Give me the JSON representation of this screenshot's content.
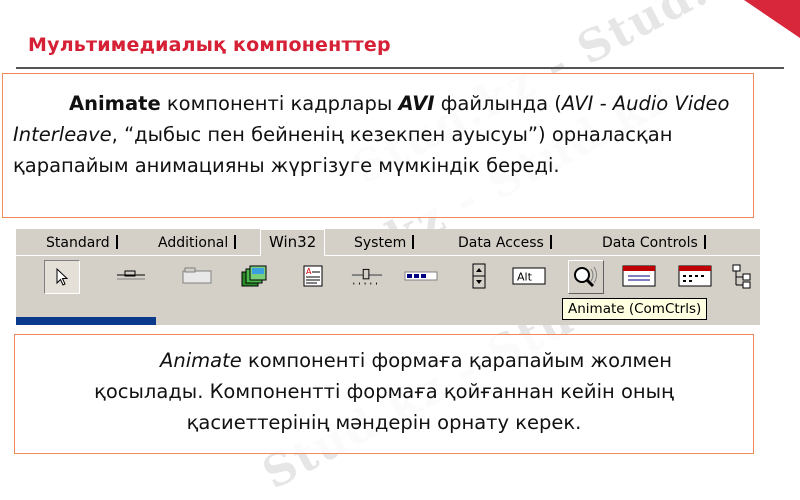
{
  "title": "Мультимедиалық компоненттер",
  "watermarks": [
    "Stud.kz - Stud.kz",
    "Stud.kz - Stud.kz",
    "Stud.kz - Stud.kz"
  ],
  "paragraph1": {
    "component": "Animate",
    "text_a": " компоненті кадрлары ",
    "format": "AVI",
    "text_b": " файлында (",
    "format_full": "AVI - Audio Video Interleave",
    "text_c": ", “дыбыс пен бейненің кезекпен ауысуы”) орналасқан қарапайым анимацияны жүргізуге мүмкіндік береді."
  },
  "palette": {
    "tabs": [
      {
        "label": "Standard"
      },
      {
        "label": "Additional"
      },
      {
        "label": "Win32"
      },
      {
        "label": "System"
      },
      {
        "label": "Data Access"
      },
      {
        "label": "Data Controls"
      }
    ],
    "tools": [
      {
        "icon": "pointer-arrow-icon"
      },
      {
        "icon": "tabcontrol-icon"
      },
      {
        "icon": "pagecontrol-icon"
      },
      {
        "icon": "imagelist-icon"
      },
      {
        "icon": "richedit-icon"
      },
      {
        "icon": "trackbar-icon"
      },
      {
        "icon": "progressbar-icon"
      },
      {
        "icon": "updown-icon"
      },
      {
        "icon": "hotkey-icon"
      },
      {
        "icon": "animate-icon"
      },
      {
        "icon": "datetimepicker-icon"
      },
      {
        "icon": "monthcalendar-icon"
      },
      {
        "icon": "treeview-icon"
      }
    ],
    "hotkey_label": "Alt",
    "tooltip": "Animate (ComCtrls)",
    "colors": {
      "face": "#d4d0c8",
      "tooltip": "#ffffe1",
      "designer": "#0b3a8c"
    }
  },
  "paragraph2": {
    "component": "Animate",
    "line1": " компоненті формаға қарапайым жолмен",
    "line2": "қосылады. Компонентті формаға қойғаннан кейін оның",
    "line3": "қасиеттерінің мәндерін орнату керек."
  },
  "colors": {
    "title": "#d52035",
    "border": "#f08a58",
    "corner": "#d8263a"
  }
}
